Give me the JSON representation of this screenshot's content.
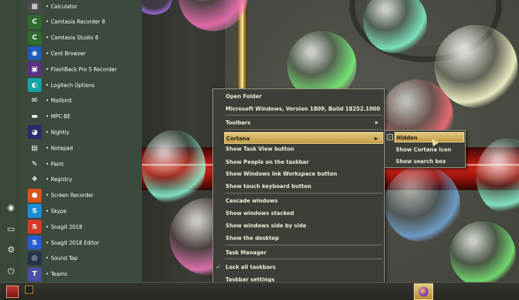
{
  "colors": {
    "menu_bg": "#3d3e37",
    "menu_highlight": "#d8b866",
    "start_bg": "#3b4a3d",
    "taskbar_bg": "#2e2f29"
  },
  "start_menu": {
    "rail_icons": [
      "user-icon",
      "pictures-icon",
      "settings-icon",
      "power-icon"
    ],
    "apps": [
      {
        "label": "Calculator",
        "icon": "calculator-icon",
        "color": "#4a4a4a",
        "glyph": "▦"
      },
      {
        "label": "Camtasia Recorder 8",
        "icon": "camtasia-recorder-icon",
        "color": "#2f6b2f",
        "glyph": "C"
      },
      {
        "label": "Camtasia Studio 8",
        "icon": "camtasia-studio-icon",
        "color": "#2f6b2f",
        "glyph": "C"
      },
      {
        "label": "Cent Browser",
        "icon": "cent-browser-icon",
        "color": "#1f5bb8",
        "glyph": "◉"
      },
      {
        "label": "FlashBack Pro 5 Recorder",
        "icon": "flashback-icon",
        "color": "#5b2f8a",
        "glyph": "▣"
      },
      {
        "label": "Logitech Options",
        "icon": "logitech-icon",
        "color": "#17a3a3",
        "glyph": "◐"
      },
      {
        "label": "Mailbird",
        "icon": "mailbird-icon",
        "color": "#3b4a3d",
        "glyph": "✉"
      },
      {
        "label": "MPC-BE",
        "icon": "mpc-be-icon",
        "color": "#3b4a3d",
        "glyph": "▬"
      },
      {
        "label": "Nightly",
        "icon": "nightly-icon",
        "color": "#2b2a6b",
        "glyph": "◕"
      },
      {
        "label": "Notepad",
        "icon": "notepad-icon",
        "color": "#3b4a3d",
        "glyph": "▤"
      },
      {
        "label": "Paint",
        "icon": "paint-icon",
        "color": "#3b4a3d",
        "glyph": "✎"
      },
      {
        "label": "Registry",
        "icon": "registry-icon",
        "color": "#3b4a3d",
        "glyph": "❖"
      },
      {
        "label": "Screen Recorder",
        "icon": "screen-recorder-icon",
        "color": "#d9541c",
        "glyph": "●"
      },
      {
        "label": "Skype",
        "icon": "skype-icon",
        "color": "#1a8fd6",
        "glyph": "S"
      },
      {
        "label": "Snagit 2018",
        "icon": "snagit-icon",
        "color": "#d63a2a",
        "glyph": "S"
      },
      {
        "label": "Snagit 2018 Editor",
        "icon": "snagit-editor-icon",
        "color": "#2a5bd6",
        "glyph": "S"
      },
      {
        "label": "Sound Tap",
        "icon": "sound-tap-icon",
        "color": "#24324a",
        "glyph": "◎"
      },
      {
        "label": "Teams",
        "icon": "teams-icon",
        "color": "#4b4fa6",
        "glyph": "T"
      }
    ],
    "bullet": "•"
  },
  "context_menu": {
    "items": [
      {
        "label": "Open Folder"
      },
      {
        "label": "Microsoft Windows, Version 1809, Build 18252.1000"
      },
      {
        "label": "Toolbars",
        "arrow": "▶"
      },
      {
        "label": "Cortana",
        "arrow": "▶",
        "selected": true
      },
      {
        "label": "Show Task View button"
      },
      {
        "label": "Show People on the taskbar"
      },
      {
        "label": "Show Windows Ink Workspace button"
      },
      {
        "label": "Show touch keyboard button"
      },
      {
        "label": "Cascade windows"
      },
      {
        "label": "Show windows stacked"
      },
      {
        "label": "Show windows side by side"
      },
      {
        "label": "Show the desktop"
      },
      {
        "label": "Task Manager"
      },
      {
        "label": "Lock all taskbars",
        "check": "✓"
      },
      {
        "label": "Taskbar settings"
      }
    ]
  },
  "cortana_submenu": {
    "items": [
      {
        "label": "Hidden",
        "selected": true
      },
      {
        "label": "Show Cortana icon"
      },
      {
        "label": "Show search box"
      }
    ],
    "check": "✓"
  },
  "taskbar": {
    "start_icon": "start-icon",
    "pinned_icon": "console-icon",
    "active_icon": "firefox-nightly-icon"
  }
}
